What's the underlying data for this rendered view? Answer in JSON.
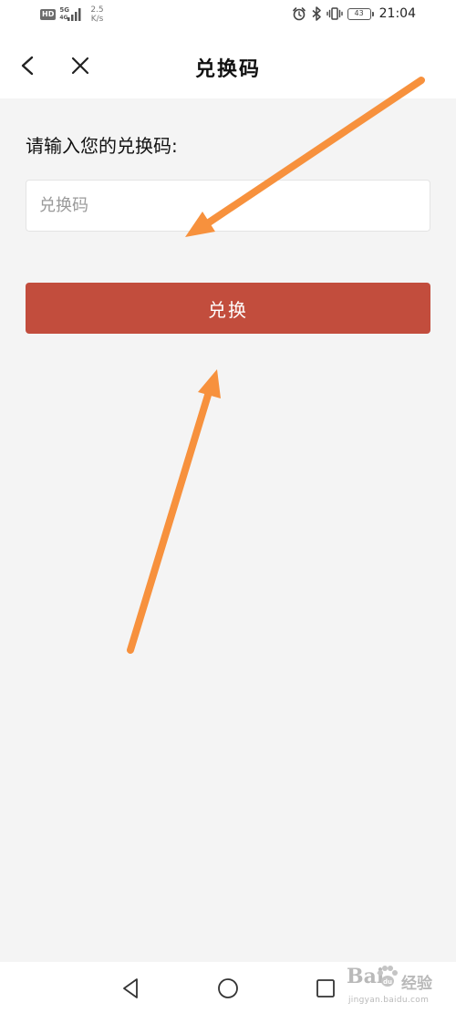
{
  "status_bar": {
    "hd": "HD",
    "network_5g": "5G",
    "network_4g": "4G",
    "speed_value": "2.5",
    "speed_unit": "K/s",
    "battery": "43",
    "time": "21:04"
  },
  "header": {
    "title": "兑换码"
  },
  "form": {
    "prompt": "请输入您的兑换码:",
    "input_placeholder": "兑换码",
    "input_value": "",
    "submit_label": "兑换"
  },
  "overlay": {
    "arrow_color": "#f7913d"
  },
  "watermark": {
    "logo": "Bai",
    "logo_cn": "经验",
    "url": "jingyan.baidu.com"
  },
  "colors": {
    "accent": "#c24d3d",
    "background": "#f4f4f4"
  }
}
